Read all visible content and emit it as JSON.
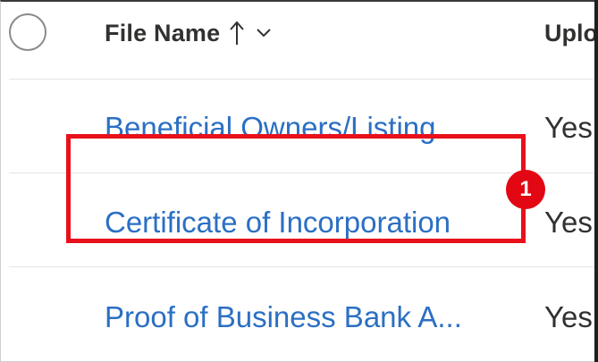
{
  "header": {
    "file_name_label": "File Name",
    "uploaded_label": "Uploaded",
    "sort_direction": "ascending"
  },
  "rows": [
    {
      "file_name": "Beneficial Owners/Listing...",
      "uploaded": "Yes"
    },
    {
      "file_name": "Certificate of Incorporation",
      "uploaded": "Yes"
    },
    {
      "file_name": "Proof of Business Bank A...",
      "uploaded": "Yes"
    }
  ],
  "annotation": {
    "step_number": "1",
    "highlight_color": "#e8111b",
    "badge_color": "#e30613"
  },
  "colors": {
    "link": "#2b6fc4",
    "text": "#323130",
    "divider": "#e4e4e4"
  },
  "icons": {
    "sort": "arrow-up-icon",
    "menu": "chevron-down-icon",
    "select": "circle-checkbox-icon"
  }
}
